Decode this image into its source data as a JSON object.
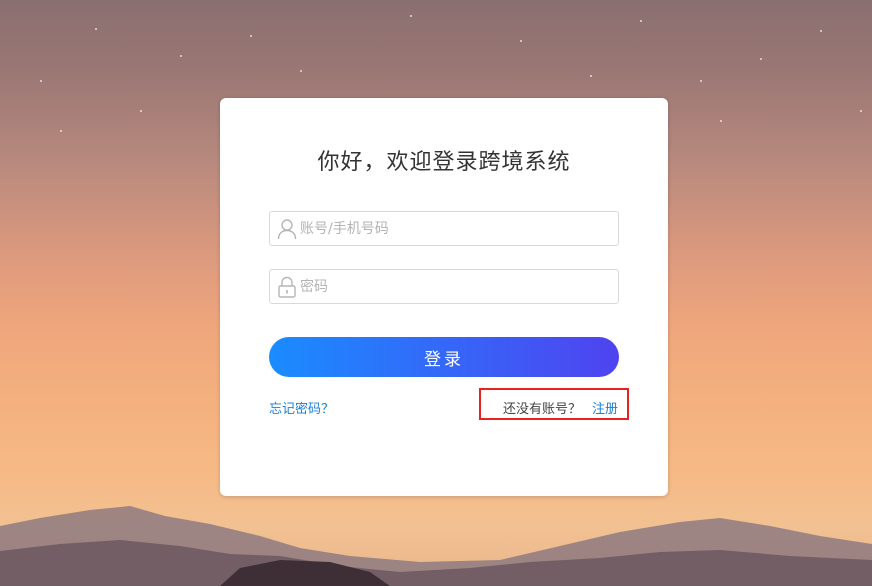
{
  "login": {
    "title": "你好，欢迎登录跨境系统",
    "username_placeholder": "账号/手机号码",
    "username_value": "",
    "password_placeholder": "密码",
    "password_value": "",
    "login_label": "登录",
    "forgot_label": "忘记密码？",
    "no_account_label": "还没有账号？",
    "register_label": "注册"
  },
  "icons": {
    "username": "user-icon",
    "password": "lock-icon"
  },
  "colors": {
    "login_gradient_start": "#1a8cff",
    "login_gradient_end": "#4f43f0",
    "link": "#1a7fd8",
    "highlight_border": "#e8231f",
    "title": "#333333"
  }
}
